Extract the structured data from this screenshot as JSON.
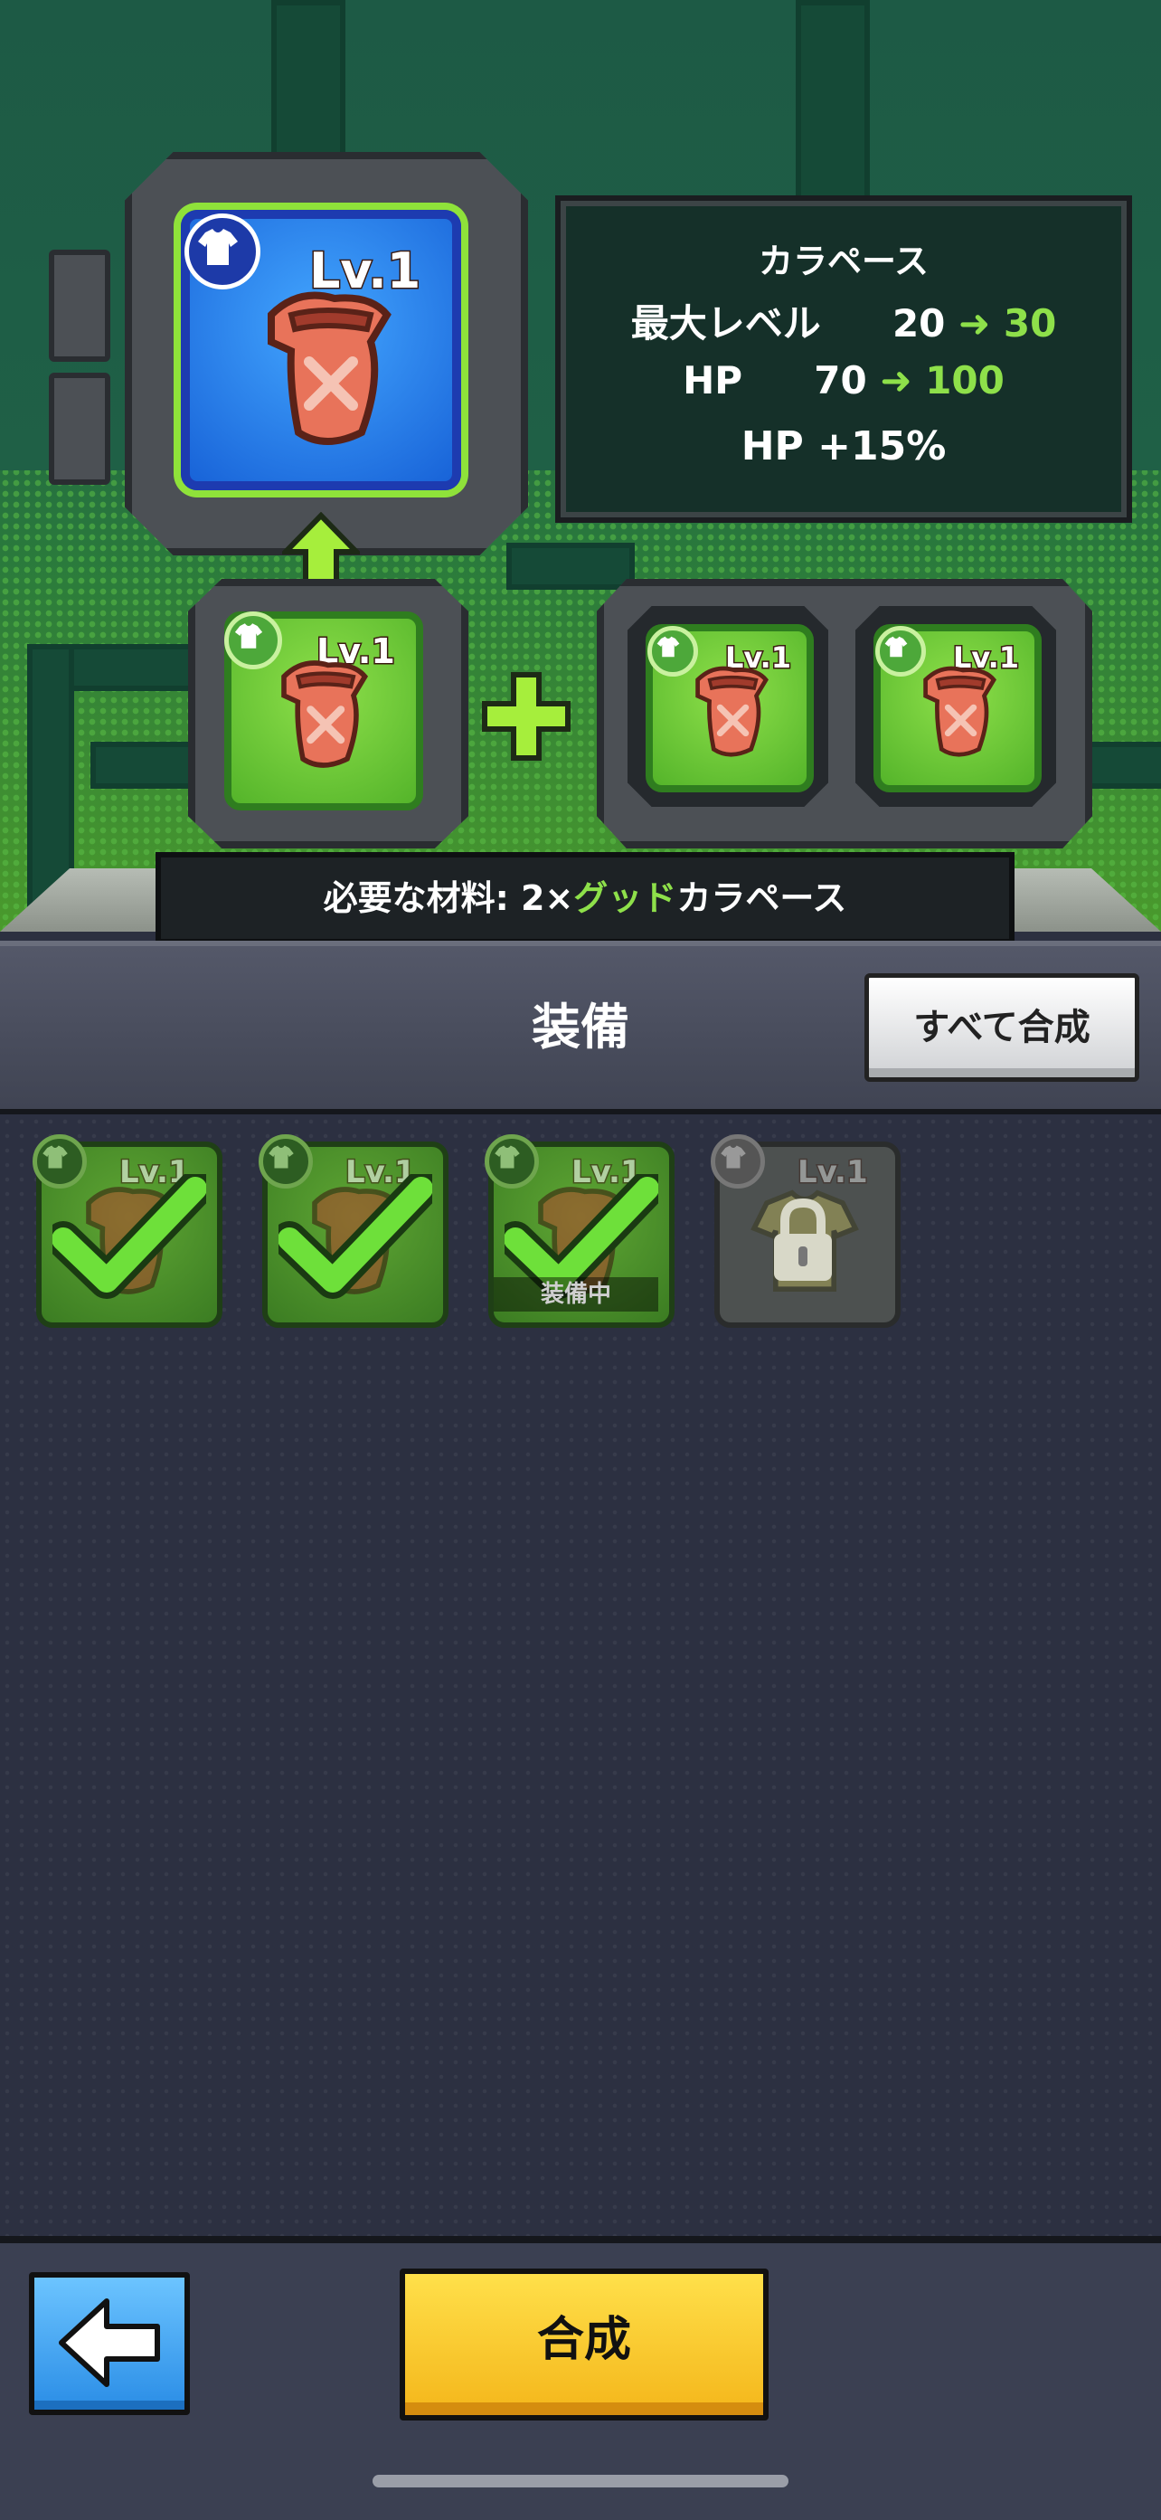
{
  "result_item": {
    "level": "Lv.1",
    "name": "カラペース"
  },
  "stats": {
    "name": "カラペース",
    "max_level_label": "最大レベル",
    "max_level_from": "20",
    "max_level_to": "30",
    "hp_label": "HP",
    "hp_from": "70",
    "hp_to": "100",
    "bonus": "HP +15%"
  },
  "materials": {
    "main": {
      "level": "Lv.1"
    },
    "extra": [
      {
        "level": "Lv.1"
      },
      {
        "level": "Lv.1"
      }
    ],
    "requirement_prefix": "必要な材料: 2×",
    "requirement_grade": "グッド",
    "requirement_item": "カラペース"
  },
  "header": {
    "title": "装備",
    "merge_all_label": "すべて合成"
  },
  "inventory": [
    {
      "level": "Lv.1",
      "selected": true,
      "equipped_label": ""
    },
    {
      "level": "Lv.1",
      "selected": true,
      "equipped_label": ""
    },
    {
      "level": "Lv.1",
      "selected": true,
      "equipped_label": "装備中"
    },
    {
      "level": "Lv.1",
      "selected": false,
      "locked": true,
      "equipped_label": ""
    }
  ],
  "footer": {
    "merge_label": "合成"
  },
  "colors": {
    "accent_green": "#8ee04a",
    "merge_button": "#f6c426",
    "back_button": "#3a9cf0"
  },
  "icons": [
    "shirt-icon",
    "armor-icon",
    "arrow-up-icon",
    "plus-icon",
    "arrow-right-icon",
    "check-icon",
    "lock-icon",
    "back-arrow-icon"
  ]
}
